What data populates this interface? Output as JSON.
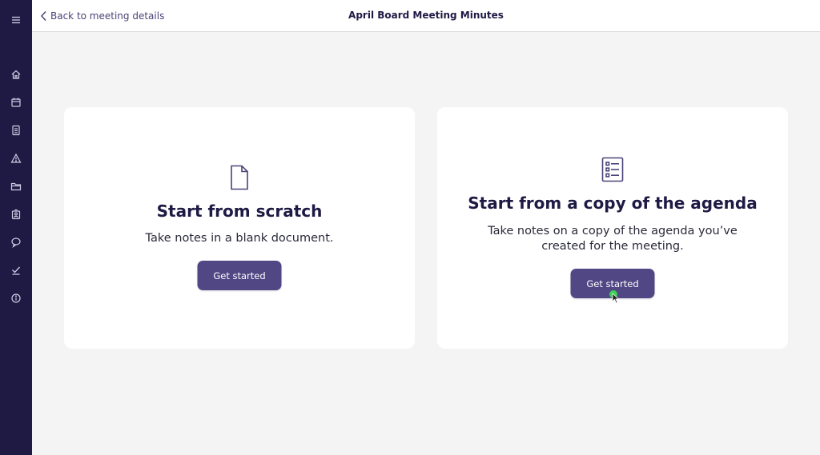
{
  "header": {
    "back_label": "Back to meeting details",
    "title": "April Board Meeting Minutes"
  },
  "sidebar": {
    "items": [
      {
        "icon": "menu-icon"
      },
      {
        "icon": "home-icon"
      },
      {
        "icon": "calendar-icon"
      },
      {
        "icon": "document-icon"
      },
      {
        "icon": "warning-icon"
      },
      {
        "icon": "folder-icon"
      },
      {
        "icon": "user-badge-icon"
      },
      {
        "icon": "chat-bubble-icon"
      },
      {
        "icon": "checkmark-icon"
      },
      {
        "icon": "info-icon"
      }
    ]
  },
  "cards": {
    "scratch": {
      "icon": "blank-document-icon",
      "title": "Start from scratch",
      "description": "Take notes in a blank document.",
      "button_label": "Get started"
    },
    "agenda": {
      "icon": "checklist-document-icon",
      "title": "Start from a copy of the agenda",
      "description": "Take notes on a copy of the agenda you’ve created for the meeting.",
      "button_label": "Get started"
    }
  },
  "colors": {
    "sidebar_bg": "#1f1a44",
    "accent": "#514785",
    "page_bg": "#f4f4f4",
    "cursor_indicator": "#39d353"
  }
}
